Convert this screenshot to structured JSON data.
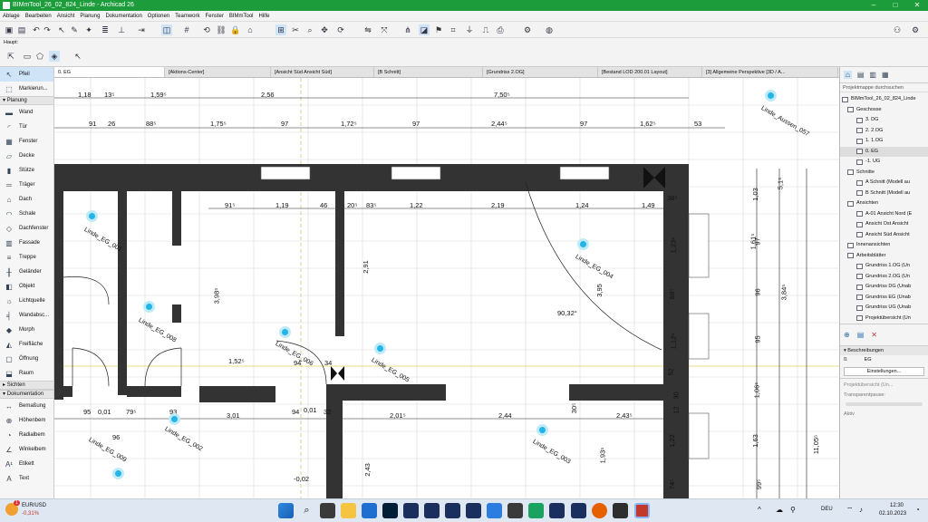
{
  "window": {
    "title": "BIMmTool_26_02_824_Linde - Archicad 26"
  },
  "menu": [
    "Ablage",
    "Bearbeiten",
    "Ansicht",
    "Planung",
    "Dokumentation",
    "Optionen",
    "Teamwork",
    "Fenster",
    "BIMmTool",
    "Hilfe"
  ],
  "info_label": "Haupt:",
  "toolbox": {
    "top": [
      {
        "label": "Pfeil",
        "icon": "arrow-icon"
      },
      {
        "label": "Markierun...",
        "icon": "marquee-icon"
      }
    ],
    "sections": [
      {
        "title": "Planung",
        "items": [
          "Wand",
          "Tür",
          "Fenster",
          "Decke",
          "Stütze",
          "Träger",
          "Dach",
          "Schale",
          "Dachfenster",
          "Fassade",
          "Treppe",
          "Geländer",
          "Objekt",
          "Lichtquelle",
          "Wandabsc...",
          "Morph",
          "Freifläche",
          "Öffnung",
          "Raum"
        ]
      },
      {
        "title": "Sichten",
        "items": []
      },
      {
        "title": "Dokumentation",
        "items": [
          "Bemaßung",
          "Höhenbem",
          "Radialbem",
          "Winkelbem",
          "Etikett",
          "Text"
        ]
      }
    ]
  },
  "tabs": [
    "0. EG",
    "[Aktions-Center]",
    "[Ansicht Süd Ansicht Süd]",
    "[B Schnitt]",
    "[Grundriss 2.OG]",
    "[Bestand LOD 200.01 Layout]",
    "[3] Allgemeine Perspektive [3D / A..."
  ],
  "dimensions_top": [
    "1,18",
    "13⁵",
    "1,59⁵",
    "2,56",
    "7,50⁵"
  ],
  "dimensions_second": [
    "91",
    "26",
    "88⁵",
    "1,75⁵",
    "97",
    "1,72⁵",
    "97",
    "2,44⁵",
    "97",
    "1,62⁵",
    "53"
  ],
  "dimensions_inner": [
    "91⁵",
    "1,19",
    "46",
    "20⁵",
    "83⁵",
    "1,22",
    "2,19",
    "1,24",
    "1,49",
    "38⁵"
  ],
  "dimensions_bottom": [
    "95",
    "0,01",
    "79⁵",
    "93",
    "3,01",
    "94",
    "0,01",
    "32",
    "2,01⁵",
    "2,44",
    "2,43⁵",
    "30⁵",
    "12"
  ],
  "dimensions_misc": [
    "1,52⁵",
    "94",
    "34",
    "96",
    "-0,02",
    "90,32°",
    "2,91",
    "3,95",
    "3,98⁵",
    "1,23⁵",
    "68⁵",
    "1,12⁵",
    "52",
    "30",
    "1,22",
    "1,93⁵",
    "2,43",
    "74⁵"
  ],
  "dimensions_right": [
    "1,03",
    "5,1⁵",
    "1,61⁵",
    "97",
    "3,84⁵",
    "96",
    "95",
    "1,06⁵",
    "1,63",
    "11,05⁵",
    "99⁵"
  ],
  "zone_labels": [
    "Linde_EG_001",
    "Linde_EG_002",
    "Linde_EG_003",
    "Linde_EG_004",
    "Linde_EG_005",
    "Linde_EG_006",
    "Linde_EG_008",
    "Linde_EG_009",
    "Linde_Aussen_057"
  ],
  "navigator": {
    "header": "Projektmappe durchsuchen",
    "items": [
      {
        "label": "BIMmTool_26_02_824_Linde",
        "lvl": 0
      },
      {
        "label": "Geschosse",
        "lvl": 1
      },
      {
        "label": "3. DG",
        "lvl": 2
      },
      {
        "label": "2. 2.OG",
        "lvl": 2
      },
      {
        "label": "1. 1.OG",
        "lvl": 2
      },
      {
        "label": "0. EG",
        "lvl": 2,
        "sel": true
      },
      {
        "label": "-1. UG",
        "lvl": 2
      },
      {
        "label": "Schnitte",
        "lvl": 1
      },
      {
        "label": "A Schnitt (Modell au",
        "lvl": 2
      },
      {
        "label": "B Schnitt (Modell au",
        "lvl": 2
      },
      {
        "label": "Ansichten",
        "lvl": 1
      },
      {
        "label": "A-01 Ansicht Nord (E",
        "lvl": 2
      },
      {
        "label": "Ansicht Ost Ansicht",
        "lvl": 2
      },
      {
        "label": "Ansicht Süd Ansicht",
        "lvl": 2
      },
      {
        "label": "Innenansichten",
        "lvl": 1
      },
      {
        "label": "Arbeitsblätter",
        "lvl": 1
      },
      {
        "label": "Grundriss 1.OG (Un",
        "lvl": 2
      },
      {
        "label": "Grundriss 2.OG (Un",
        "lvl": 2
      },
      {
        "label": "Grundriss DG (Unab",
        "lvl": 2
      },
      {
        "label": "Grundriss EG (Unab",
        "lvl": 2
      },
      {
        "label": "Grundriss UG (Unab",
        "lvl": 2
      },
      {
        "label": "Projektübersicht (Un",
        "lvl": 2
      }
    ],
    "beschreibungen": "Beschreibungen",
    "field_id": "0.",
    "field_name": "EG",
    "settings_button": "Einstellungen...",
    "projektuebersicht": "Projektübersicht (Un...",
    "transparenz": "Transparentpause:",
    "aktiv": "Aktiv"
  },
  "taskbar": {
    "stock_name": "EUR/USD",
    "stock_change": "-0,31%",
    "lang": "DEU",
    "time": "12:30",
    "date": "02.10.2023",
    "badge": "1"
  }
}
